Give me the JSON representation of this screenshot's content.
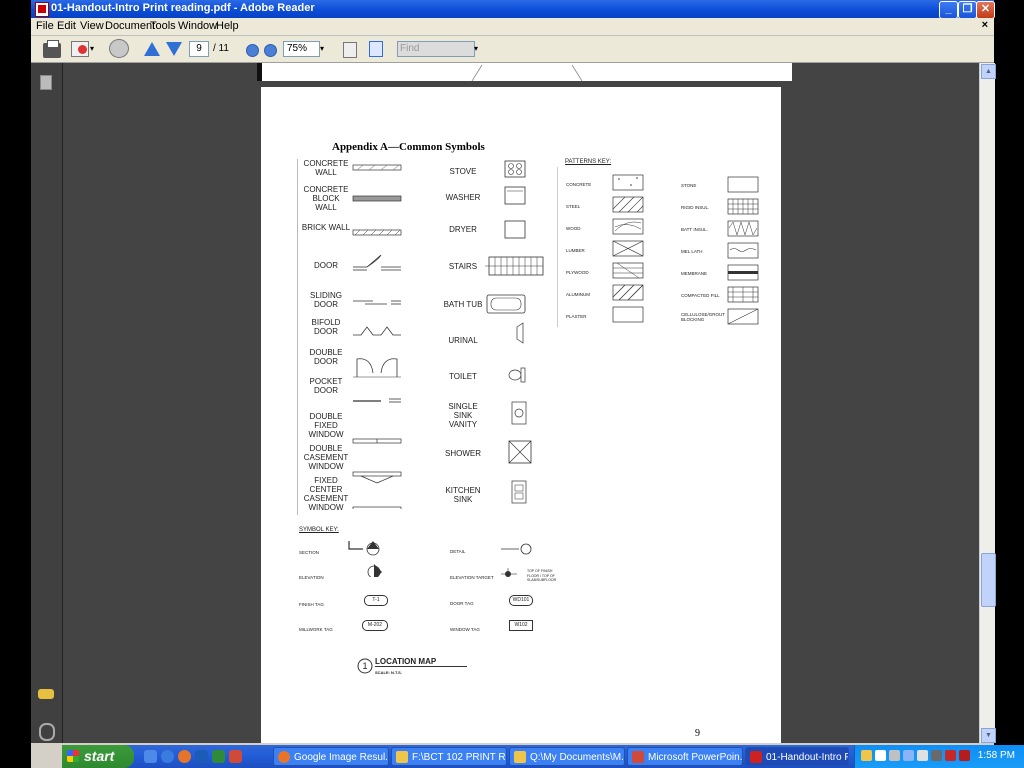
{
  "window": {
    "title": "01-Handout-Intro Print reading.pdf - Adobe Reader",
    "close_doc": "×"
  },
  "menu": [
    "File",
    "Edit",
    "View",
    "Document",
    "Tools",
    "Window",
    "Help"
  ],
  "toolbar": {
    "page_current": "9",
    "page_total": "/ 11",
    "zoom": "75%",
    "find_placeholder": "Find"
  },
  "document": {
    "appendix_title": "Appendix A—Common Symbols",
    "left_column": [
      "CONCRETE WALL",
      "CONCRETE BLOCK WALL",
      "BRICK WALL",
      "DOOR",
      "SLIDING DOOR",
      "BIFOLD DOOR",
      "DOUBLE DOOR",
      "POCKET DOOR",
      "DOUBLE FIXED WINDOW",
      "DOUBLE CASEMENT WINDOW",
      "FIXED CENTER CASEMENT WINDOW"
    ],
    "middle_column": [
      "STOVE",
      "WASHER",
      "DRYER",
      "STAIRS",
      "BATH TUB",
      "URINAL",
      "TOILET",
      "SINGLE SINK VANITY",
      "SHOWER",
      "KITCHEN SINK"
    ],
    "patterns_key": {
      "title": "PATTERNS KEY:",
      "left": [
        "CONCRETE",
        "STEEL",
        "WOOD",
        "LUMBER",
        "PLYWOOD",
        "ALUMINUM",
        "PLASTER"
      ],
      "right": [
        "STONE",
        "RIGID INSUL.",
        "BATT INSUL.",
        "MEL LATH",
        "MEMBRANE",
        "COMPACTED FILL",
        "CELLULOSE/GROUT BLOCKING"
      ]
    },
    "symbol_key": {
      "title": "SYMBOL KEY:",
      "left": [
        "SECTION",
        "ELEVATION",
        "FINISH TAG",
        "MILLWORK TAG"
      ],
      "left_tags": [
        "T-1",
        "M-202"
      ],
      "right": [
        "DETAIL",
        "ELEVATION TARGET",
        "DOOR TAG",
        "WINDOW TAG"
      ],
      "right_tags": [
        "WD101",
        "W102"
      ],
      "target_note": "TOP OF FINISH FLOOR / TOP OF SLAB/SUBFLOOR"
    },
    "location_map": {
      "number": "1",
      "label": "LOCATION MAP",
      "scale": "SCALE: N.T.S."
    },
    "page_number": "9"
  },
  "taskbar": {
    "start": "start",
    "tasks": [
      "Google Image Resul...",
      "F:\\BCT 102 PRINT R...",
      "Q:\\My Documents\\M...",
      "Microsoft PowerPoin...",
      "01-Handout-Intro Pr..."
    ],
    "clock": "1:58 PM"
  },
  "colors": {
    "titlebar": "#0a4bd6",
    "taskbar": "#245ed8",
    "tray": "#0f8df5",
    "start": "#2f8a2f"
  }
}
